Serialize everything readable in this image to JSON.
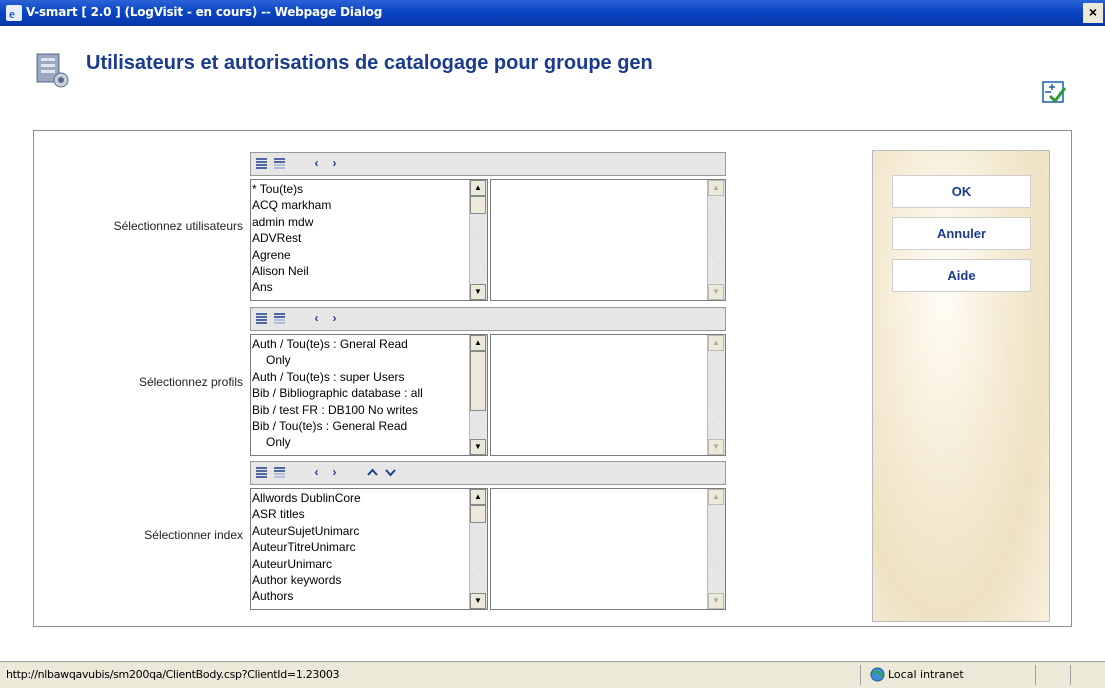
{
  "window": {
    "title": "V-smart [ 2.0 ] (LogVisit - en cours) -- Webpage Dialog",
    "close_label": "×"
  },
  "page": {
    "title": "Utilisateurs et autorisations de catalogage pour groupe gen"
  },
  "rows": {
    "users": {
      "label": "Sélectionnez utilisateurs",
      "items": [
        "* Tou(te)s",
        "ACQ markham",
        "admin mdw",
        "ADVRest",
        "Agrene",
        "Alison Neil",
        "Ans"
      ]
    },
    "profiles": {
      "label": "Sélectionnez profils",
      "items": [
        "Auth / Tou(te)s : Gneral Read",
        "Only",
        "Auth / Tou(te)s : super Users",
        "Bib / Bibliographic database : all",
        "Bib / test FR : DB100 No writes",
        "Bib / Tou(te)s : General Read",
        "Only"
      ]
    },
    "index": {
      "label": "Sélectionner index",
      "items": [
        "Allwords DublinCore",
        "ASR titles",
        "AuteurSujetUnimarc",
        "AuteurTitreUnimarc",
        "AuteurUnimarc",
        "Author keywords",
        "Authors"
      ]
    }
  },
  "toolbar": {
    "select_all_icon": "list-select-all-icon",
    "deselect_icon": "list-deselect-icon",
    "move_left": "‹",
    "move_right": "›",
    "move_up": "⌃",
    "move_down": "⌄"
  },
  "buttons": {
    "ok": "OK",
    "cancel": "Annuler",
    "help": "Aide"
  },
  "statusbar": {
    "url": "http://nlbawqavubis/sm200qa/ClientBody.csp?ClientId=1.23003",
    "zone": "Local intranet"
  },
  "colors": {
    "title_blue": "#1a3b8e",
    "titlebar": "#0a45c4"
  }
}
